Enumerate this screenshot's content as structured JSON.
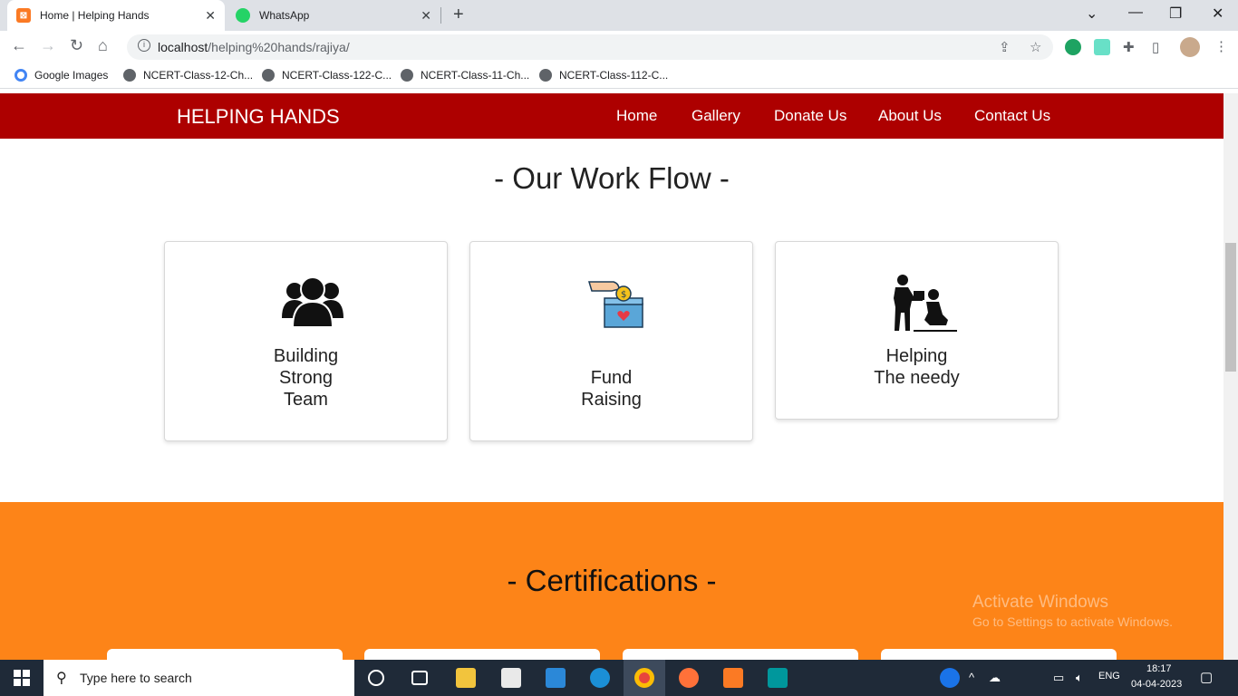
{
  "browser": {
    "tabs": [
      {
        "title": "Home | Helping Hands",
        "close": "✕"
      },
      {
        "title": "WhatsApp",
        "close": "✕"
      }
    ],
    "new_tab": "+",
    "url_host": "localhost",
    "url_path": "/helping%20hands/rajiya/",
    "bookmarks": [
      "Google Images",
      "NCERT-Class-12-Ch...",
      "NCERT-Class-122-C...",
      "NCERT-Class-11-Ch...",
      "NCERT-Class-112-C..."
    ]
  },
  "navbar": {
    "brand": "HELPING HANDS",
    "links": [
      "Home",
      "Gallery",
      "Donate Us",
      "About Us",
      "Contact Us"
    ],
    "color": "#ad0000"
  },
  "workflow": {
    "title": "- Our Work Flow -",
    "cards": [
      {
        "line1": "Building",
        "line2": "Strong",
        "line3": "Team",
        "icon": "team-icon"
      },
      {
        "line1": "Fund",
        "line2": "Raising",
        "icon": "donation-box-icon"
      },
      {
        "line1": "Helping",
        "line2": "The needy",
        "icon": "helping-person-icon"
      }
    ]
  },
  "certifications": {
    "title": "- Certifications -",
    "color": "#fd8418"
  },
  "watermark": {
    "line1": "Activate Windows",
    "line2": "Go to Settings to activate Windows."
  },
  "taskbar": {
    "search_placeholder": "Type here to search",
    "lang": "ENG",
    "time": "18:17",
    "date": "04-04-2023"
  }
}
